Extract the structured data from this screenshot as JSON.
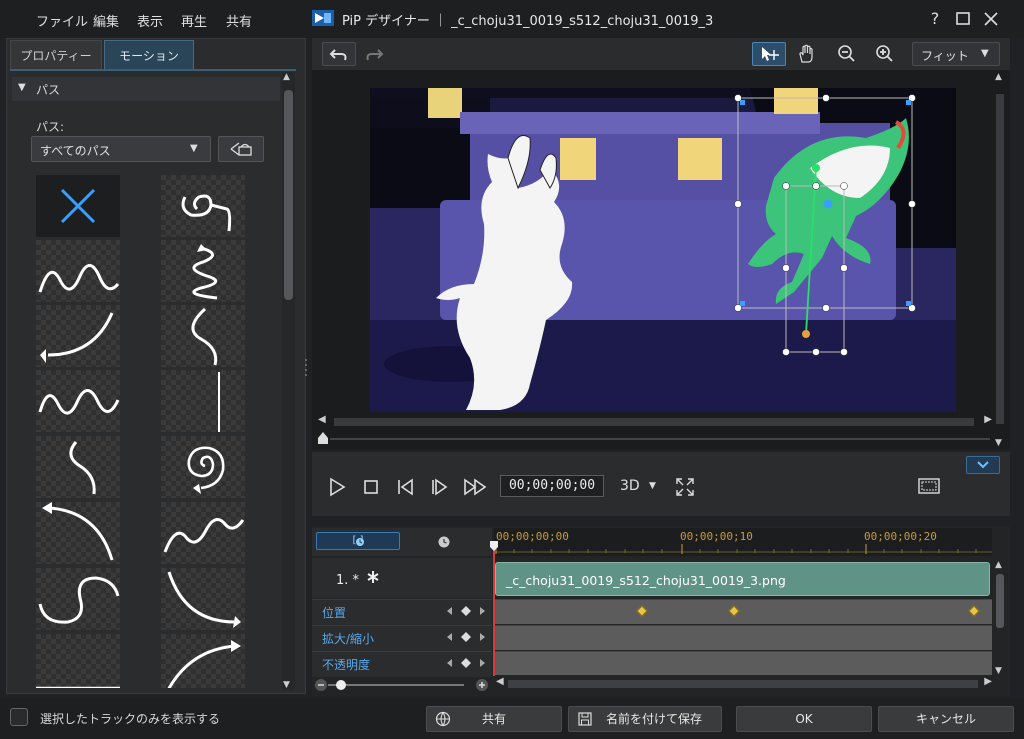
{
  "menu": [
    "ファイル",
    "編集",
    "表示",
    "再生",
    "共有"
  ],
  "window": {
    "title": "PiP デザイナー ｜ _c_choju31_0019_s512_choju31_0019_3",
    "help_label": "?"
  },
  "left_panel": {
    "tabs": [
      "プロパティー",
      "モーション"
    ],
    "active_tab": "モーション",
    "section_header": "パス",
    "path_label": "パス:",
    "path_select_value": "すべてのパス"
  },
  "toolbar": {
    "fit_label": "フィット",
    "icons": [
      "undo-icon",
      "redo-icon",
      "move-icon",
      "hand-icon",
      "zoom-out-icon",
      "zoom-in-icon"
    ]
  },
  "playback": {
    "timecode": "00;00;00;00",
    "mode_3d": "3D"
  },
  "timeline": {
    "ruler_labels": [
      "00;00;00;00",
      "00;00;00;10",
      "00;00;00;20"
    ],
    "track_name": "1. *",
    "clip_label": "_c_choju31_0019_s512_choju31_0019_3.png",
    "keyframe_rows": [
      "位置",
      "拡大/縮小",
      "不透明度"
    ],
    "view_button_label": "[ ]"
  },
  "bottom": {
    "checkbox_label": "選択したトラックのみを表示する",
    "share_label": "共有",
    "save_as_label": "名前を付けて保存",
    "ok_label": "OK",
    "cancel_label": "キャンセル"
  },
  "colors": {
    "accent": "#3aa0ff",
    "keyframe": "#e6c64a",
    "clip": "#5f9385",
    "label_blue": "#59a8ea"
  }
}
